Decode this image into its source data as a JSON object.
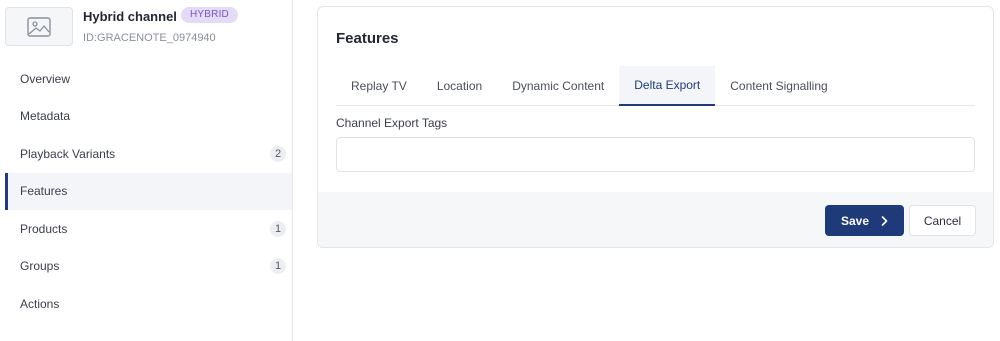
{
  "channel": {
    "title": "Hybrid channel",
    "type_badge": "HYBRID",
    "id_text": "ID:GRACENOTE_0974940",
    "thumbnail_icon": "image-placeholder-icon"
  },
  "sidebar": {
    "items": [
      {
        "label": "Overview",
        "count": null,
        "active": false
      },
      {
        "label": "Metadata",
        "count": null,
        "active": false
      },
      {
        "label": "Playback Variants",
        "count": "2",
        "active": false
      },
      {
        "label": "Features",
        "count": null,
        "active": true
      },
      {
        "label": "Products",
        "count": "1",
        "active": false
      },
      {
        "label": "Groups",
        "count": "1",
        "active": false
      },
      {
        "label": "Actions",
        "count": null,
        "active": false
      }
    ]
  },
  "main": {
    "title": "Features",
    "tabs": [
      {
        "label": "Replay TV",
        "active": false
      },
      {
        "label": "Location",
        "active": false
      },
      {
        "label": "Dynamic Content",
        "active": false
      },
      {
        "label": "Delta Export",
        "active": true
      },
      {
        "label": "Content Signalling",
        "active": false
      }
    ],
    "field": {
      "label": "Channel Export Tags",
      "value": "",
      "placeholder": ""
    },
    "actions": {
      "save_label": "Save",
      "cancel_label": "Cancel"
    }
  },
  "colors": {
    "accent": "#1e3a78",
    "badge_bg": "#e4dcf6",
    "badge_text": "#7a55c9"
  }
}
